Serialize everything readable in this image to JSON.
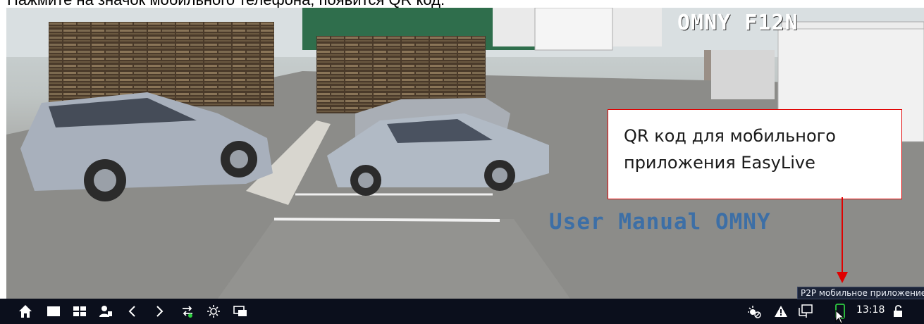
{
  "caption": {
    "text": "Нажмите на значок мобильного телефона, появится QR код."
  },
  "video": {
    "camera_name": "OMNY F12N",
    "watermark": "User Manual OMNY"
  },
  "callout": {
    "text": "QR код для мобильного приложения EasyLive",
    "border_color": "#e00000"
  },
  "taskbar": {
    "left_icons": [
      "home-icon",
      "single-view-icon",
      "quad-view-icon",
      "user-icon",
      "chevron-left-icon",
      "chevron-right-icon",
      "swap-icon",
      "brightness-icon",
      "screen-icon"
    ],
    "right_icons": [
      "weather-icon",
      "warning-icon",
      "network-icon",
      "mobile-phone-icon",
      "lock-icon"
    ],
    "time": "13:18",
    "tooltip": "P2P мобильное приложение"
  },
  "colors": {
    "taskbar_bg": "#0b0f1c",
    "watermark": "#3d6fa6",
    "accent_green": "#2ecc40"
  }
}
